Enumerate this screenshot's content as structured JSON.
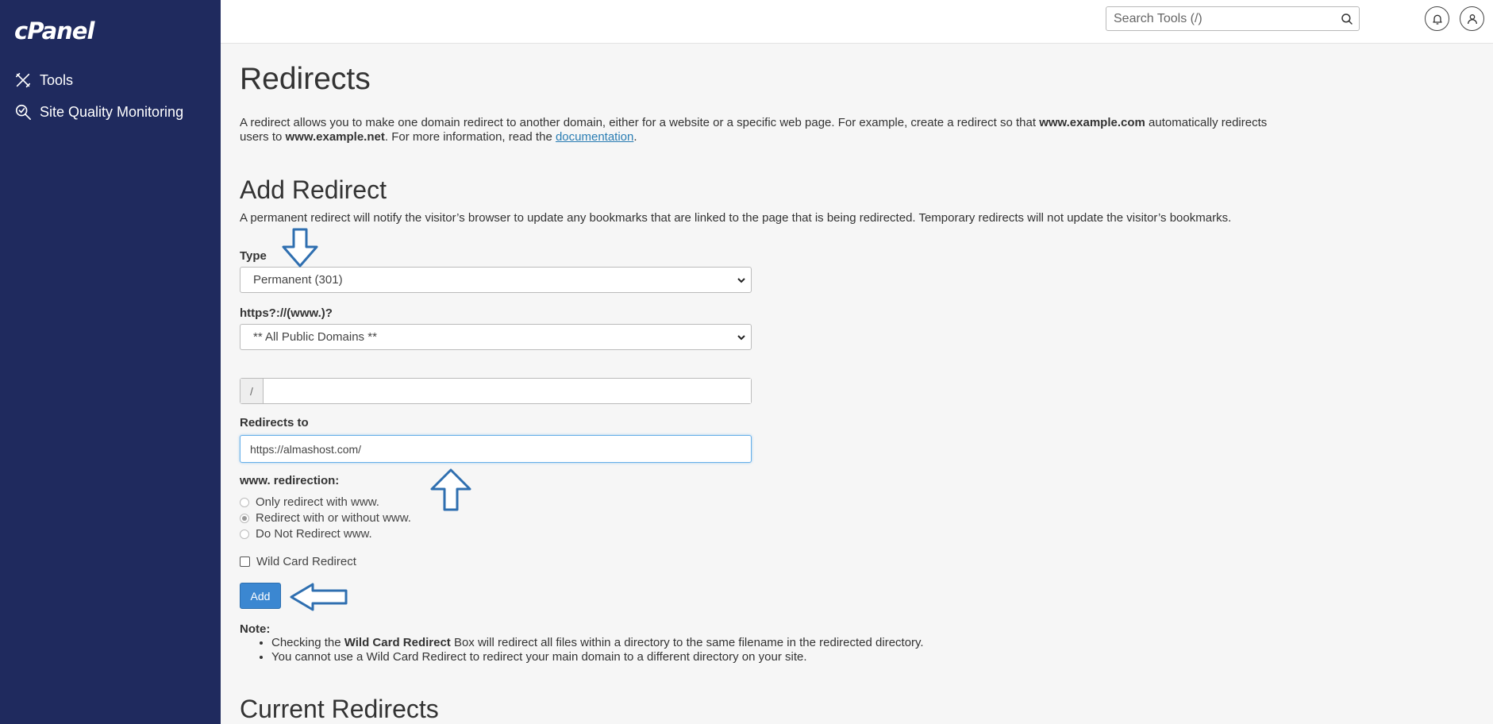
{
  "sidebar": {
    "logo": "cPanel",
    "items": [
      {
        "label": "Tools",
        "icon": "tools-icon"
      },
      {
        "label": "Site Quality Monitoring",
        "icon": "site-quality-icon"
      }
    ]
  },
  "topbar": {
    "search_placeholder": "Search Tools (/)"
  },
  "page": {
    "title": "Redirects",
    "intro_part1": "A redirect allows you to make one domain redirect to another domain, either for a website or a specific web page. For example, create a redirect so that ",
    "intro_bold1": "www.example.com",
    "intro_part2": " automatically redirects users to ",
    "intro_bold2": "www.example.net",
    "intro_part3": ". For more information, read the ",
    "intro_link": "documentation",
    "intro_part4": "."
  },
  "add_redirect": {
    "heading": "Add Redirect",
    "description": "A permanent redirect will notify the visitor’s browser to update any bookmarks that are linked to the page that is being redirected. Temporary redirects will not update the visitor’s bookmarks.",
    "type_label": "Type",
    "type_value": "Permanent (301)",
    "domain_label": "https?://(www.)?",
    "domain_value": "** All Public Domains **",
    "path_prefix": "/",
    "path_value": "",
    "redirects_to_label": "Redirects to",
    "redirects_to_value": "https://almashost.com/",
    "www_label": "www. redirection:",
    "www_options": [
      {
        "label": "Only redirect with www.",
        "checked": false
      },
      {
        "label": "Redirect with or without www.",
        "checked": true
      },
      {
        "label": "Do Not Redirect www.",
        "checked": false
      }
    ],
    "wildcard_label": "Wild Card Redirect",
    "wildcard_checked": false,
    "add_button": "Add"
  },
  "note": {
    "title": "Note:",
    "item1_prefix": "Checking the ",
    "item1_bold": "Wild Card Redirect",
    "item1_suffix": " Box will redirect all files within a directory to the same filename in the redirected directory.",
    "item2": "You cannot use a Wild Card Redirect to redirect your main domain to a different directory on your site."
  },
  "current_redirects": {
    "heading": "Current Redirects"
  },
  "colors": {
    "sidebar_bg": "#1f2a5e",
    "button_blue": "#3b87d1",
    "annotation_arrow": "#2f6fb0"
  }
}
